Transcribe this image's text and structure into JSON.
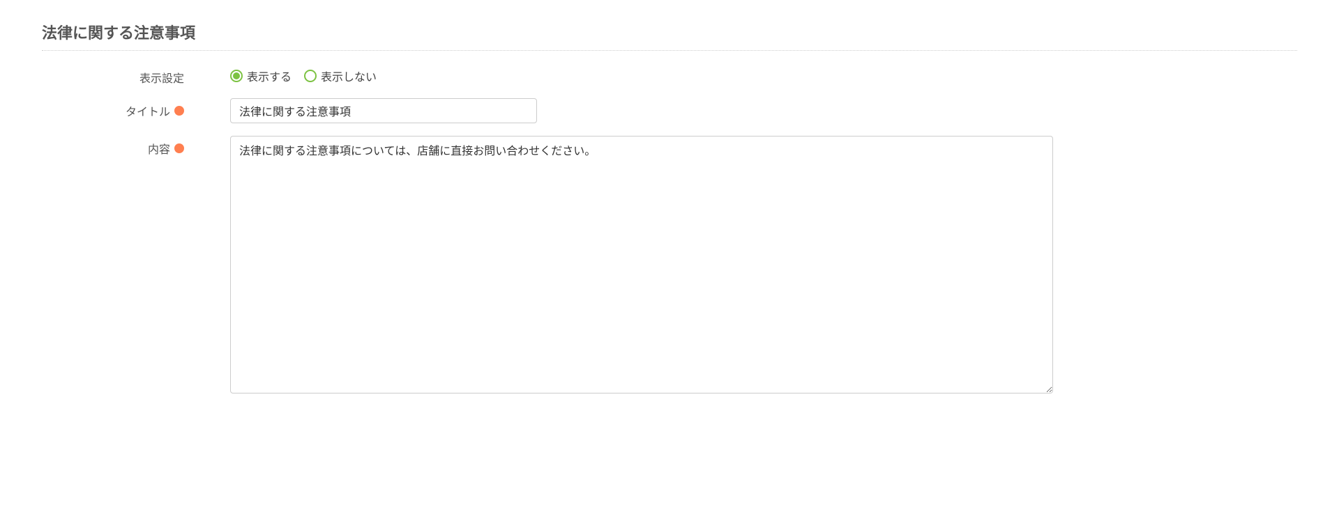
{
  "section": {
    "title": "法律に関する注意事項"
  },
  "form": {
    "display_setting": {
      "label": "表示設定",
      "options": {
        "show": "表示する",
        "hide": "表示しない"
      },
      "selected": "show"
    },
    "title_field": {
      "label": "タイトル",
      "value": "法律に関する注意事項",
      "required": true
    },
    "content_field": {
      "label": "内容",
      "value": "法律に関する注意事項については、店舗に直接お問い合わせください。",
      "required": true
    }
  },
  "colors": {
    "accent_green": "#7cc242",
    "required_orange": "#ff7f50"
  }
}
